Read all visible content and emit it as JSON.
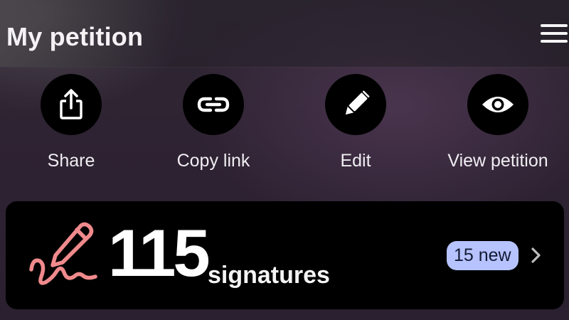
{
  "header": {
    "title": "My petition",
    "menu_icon": "hamburger-menu-icon"
  },
  "actions": [
    {
      "label": "Share",
      "icon": "share-icon"
    },
    {
      "label": "Copy link",
      "icon": "link-icon"
    },
    {
      "label": "Edit",
      "icon": "pencil-icon"
    },
    {
      "label": "View petition",
      "icon": "eye-icon"
    }
  ],
  "signatures": {
    "count": "115",
    "label": "signatures",
    "new_badge": "15 new",
    "icon": "signature-pen-icon",
    "chevron_icon": "chevron-right-icon"
  },
  "colors": {
    "background": "#2b2230",
    "card": "#000000",
    "action_circle": "#000000",
    "signature_icon": "#f08a8c",
    "badge_bg": "#b6c3ff",
    "badge_text": "#141a33"
  }
}
